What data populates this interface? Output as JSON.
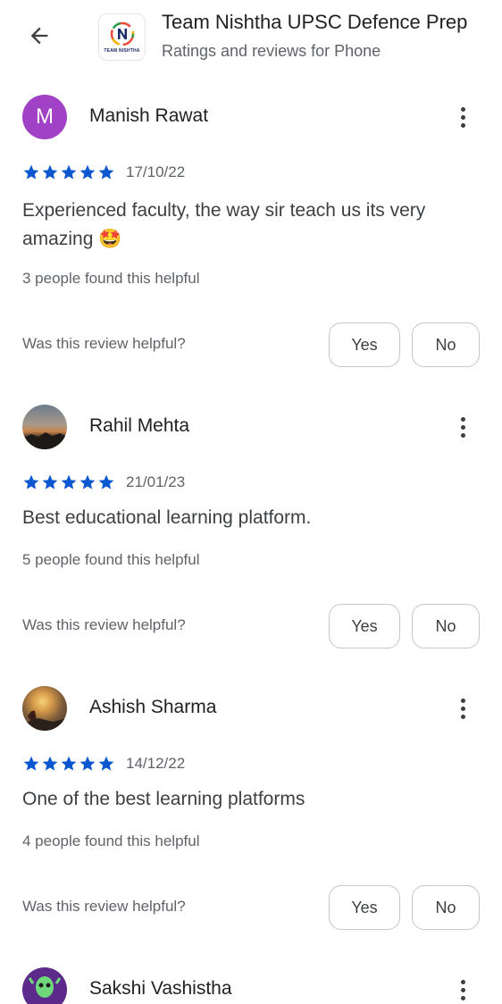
{
  "header": {
    "app_title": "Team Nishtha UPSC Defence Prep",
    "subtitle": "Ratings and reviews for Phone",
    "app_icon_text": "TEAM NISHTHA"
  },
  "reviews": [
    {
      "name": "Manish Rawat",
      "avatar_letter": "M",
      "avatar_color": "#a142c6",
      "rating": 5,
      "date": "17/10/22",
      "text": "Experienced faculty, the way sir teach us its very amazing 🤩",
      "helpful_count": "3 people found this helpful",
      "helpful_question": "Was this review helpful?",
      "yes_label": "Yes",
      "no_label": "No"
    },
    {
      "name": "Rahil Mehta",
      "rating": 5,
      "date": "21/01/23",
      "text": "Best educational learning platform.",
      "helpful_count": "5 people found this helpful",
      "helpful_question": "Was this review helpful?",
      "yes_label": "Yes",
      "no_label": "No"
    },
    {
      "name": "Ashish Sharma",
      "rating": 5,
      "date": "14/12/22",
      "text": "One of the best learning platforms",
      "helpful_count": "4 people found this helpful",
      "helpful_question": "Was this review helpful?",
      "yes_label": "Yes",
      "no_label": "No"
    },
    {
      "name": "Sakshi Vashistha"
    }
  ],
  "colors": {
    "star": "#0b57d0",
    "avatar_m": "#a142c6"
  }
}
